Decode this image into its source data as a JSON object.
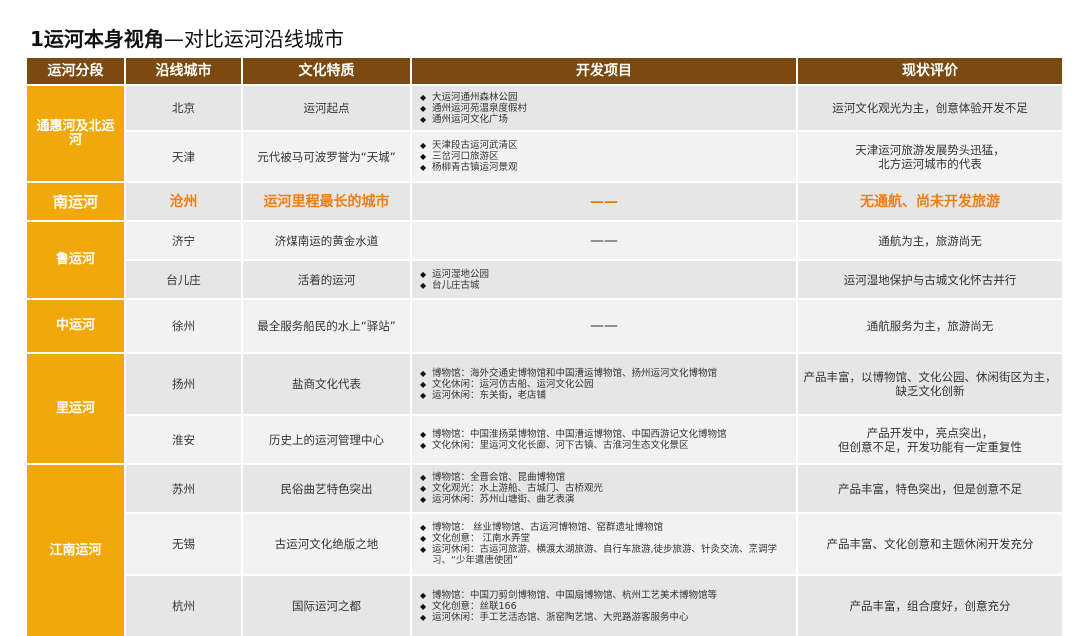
{
  "title": {
    "bold": "1运河本身视角",
    "rest": "—对比运河沿线城市"
  },
  "headers": [
    "运河分段",
    "沿线城市",
    "文化特质",
    "开发项目",
    "现状评价"
  ],
  "segments": [
    "通惠河及北运河",
    "南运河",
    "鲁运河",
    "中运河",
    "里运河",
    "江南运河"
  ],
  "rows": [
    {
      "city": "北京",
      "culture": "运河起点",
      "projects": [
        "大运河通州森林公园",
        "通州运河苑温泉度假村",
        "通州运河文化广场"
      ],
      "evaluation": "运河文化观光为主，创意体验开发不足"
    },
    {
      "city": "天津",
      "culture": "元代被马可波罗誉为“天城”",
      "projects": [
        "天津段古运河武清区",
        "三岔河口旅游区",
        "杨柳青古镇运河景观"
      ],
      "evaluation": "天津运河旅游发展势头迅猛，\n北方运河城市的代表"
    },
    {
      "city": "沧州",
      "culture": "运河里程最长的城市",
      "projects_text": "——",
      "evaluation": "无通航、尚未开发旅游"
    },
    {
      "city": "济宁",
      "culture": "济煤南运的黄金水道",
      "projects_text": "——",
      "evaluation": "通航为主，旅游尚无"
    },
    {
      "city": "台儿庄",
      "culture": "活着的运河",
      "projects": [
        "运河湿地公园",
        "台儿庄古城"
      ],
      "evaluation": "运河湿地保护与古城文化怀古并行"
    },
    {
      "city": "徐州",
      "culture": "最全服务船民的水上“驿站”",
      "projects_text": "——",
      "evaluation": "通航服务为主，旅游尚无"
    },
    {
      "city": "扬州",
      "culture": "盐商文化代表",
      "projects": [
        "博物馆：海外交通史博物馆和中国漕运博物馆、扬州运河文化博物馆",
        "文化休闲：运河仿古船、运河文化公园",
        "运河休闲：东关街，老店铺"
      ],
      "evaluation": "产品丰富，以博物馆、文化公园、休闲街区为主，\n缺乏文化创新"
    },
    {
      "city": "淮安",
      "culture": "历史上的运河管理中心",
      "projects": [
        "博物馆：中国淮扬菜博物馆、中国漕运博物馆、中国西游记文化博物馆",
        "文化休闲：里运河文化长廊、河下古镇、古淮河生态文化景区"
      ],
      "evaluation": "产品开发中，亮点突出，\n但创意不足，开发功能有一定重复性"
    },
    {
      "city": "苏州",
      "culture": "民俗曲艺特色突出",
      "projects": [
        "博物馆：全晋会馆、昆曲博物馆",
        "文化观光：水上游船、古城门、古桥观光",
        "运河休闲：苏州山塘街、曲艺表演"
      ],
      "evaluation": "产品丰富，特色突出，但是创意不足"
    },
    {
      "city": "无锡",
      "culture": "古运河文化绝版之地",
      "projects": [
        "博物馆： 丝业博物馆、古运河博物馆、窑群遗址博物馆",
        "文化创意： 江南水弄堂",
        "运河休闲：古运河旅游、横渡太湖旅游、自行车旅游,徒步旅游、针灸交流、烹调学习、“少年遣唐使团”"
      ],
      "evaluation": "产品丰富、文化创意和主题休闲开发充分"
    },
    {
      "city": "杭州",
      "culture": "国际运河之都",
      "projects": [
        "博物馆：中国刀剪剑博物馆、中国扇博物馆、杭州工艺美术博物馆等",
        "文化创意：丝联166",
        "运河休闲：手工艺活态馆、浙窑陶艺馆、大兜路游客服务中心"
      ],
      "evaluation": "产品丰富，组合度好，创意充分"
    }
  ],
  "colors": {
    "header": "#7a4a12",
    "segment": "#f0a80a",
    "highlight": "#f07d10",
    "row_a": "#e6e6e6",
    "row_b": "#f2f2f2"
  }
}
